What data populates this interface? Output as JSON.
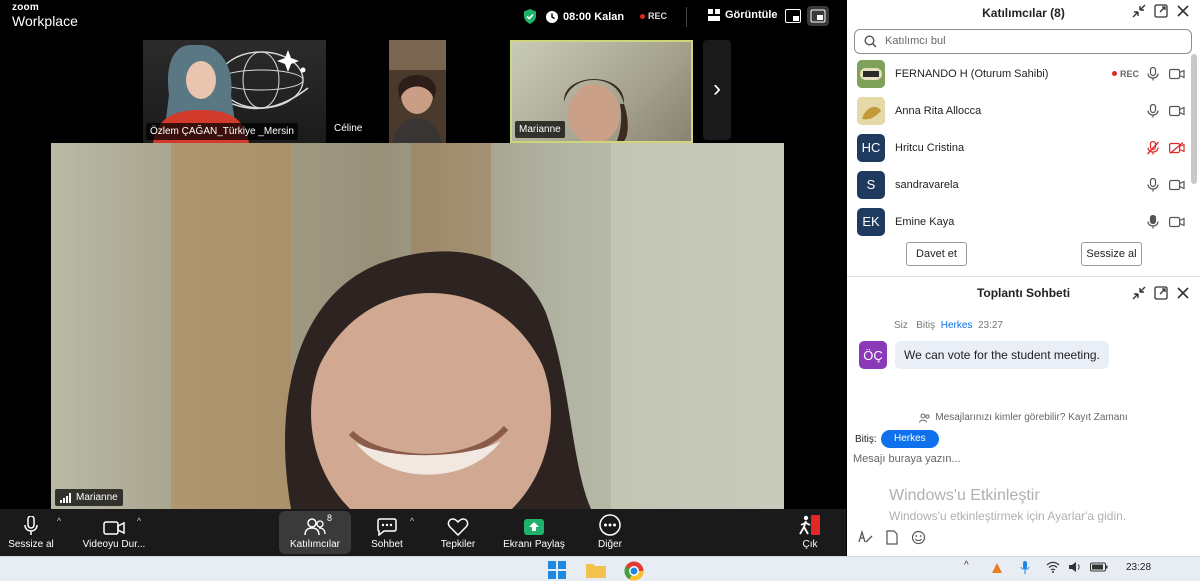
{
  "topbar": {
    "logo_line1": "zoom",
    "logo_line2": "Workplace",
    "timer": "08:00 Kalan",
    "rec": "REC",
    "view_label": "Görüntüle"
  },
  "thumbnails": [
    {
      "name": "Özlem ÇAĞAN_Türkiye _Mersin"
    },
    {
      "name": "Céline"
    },
    {
      "name": "Marianne"
    }
  ],
  "main_video": {
    "name": "Marianne"
  },
  "toolbar": {
    "mute": "Sessize al",
    "video": "Videoyu Dur...",
    "participants": "Katılımcılar",
    "participants_count": "8",
    "chat": "Sohbet",
    "reactions": "Tepkiler",
    "share": "Ekranı Paylaş",
    "more": "Diğer",
    "leave": "Çık"
  },
  "participants_panel": {
    "title": "Katılımcılar (8)",
    "search_placeholder": "Katılımcı bul",
    "rec_label": "REC",
    "items": [
      {
        "name": "FERNANDO H (Oturum Sahibi)",
        "initials": "",
        "color": "#6b8e4e",
        "mic_muted": false
      },
      {
        "name": "Anna Rita Allocca",
        "initials": "",
        "color": "#c9b47a",
        "mic_muted": false
      },
      {
        "name": "Hritcu Cristina",
        "initials": "HC",
        "color": "#1f3a5f",
        "mic_muted": true
      },
      {
        "name": "sandravarela",
        "initials": "S",
        "color": "#1f3a5f",
        "mic_muted": false
      },
      {
        "name": "Emine Kaya",
        "initials": "EK",
        "color": "#1f3a5f",
        "mic_muted": false
      }
    ],
    "invite_button": "Davet et",
    "mute_all_button": "Sessize al"
  },
  "chat_panel": {
    "title": "Toplantı Sohbeti",
    "meta_from": "Siz",
    "meta_to_label": "Bitiş",
    "meta_to": "Herkes",
    "meta_time": "23:27",
    "avatar_initials": "ÖÇ",
    "message": "We can vote for the student meeting.",
    "privacy": "Mesajlarınızı kimler görebilir? Kayıt Zamanı",
    "to_label": "Bitiş:",
    "to_chip": "Herkes",
    "input_placeholder": "Mesajı buraya yazın..."
  },
  "windows_activation": {
    "title": "Windows'u Etkinleştir",
    "subtitle": "Windows'u etkinleştirmek için Ayarlar'a gidin."
  },
  "taskbar": {
    "time": "23:28"
  },
  "colors": {
    "accent_blue": "#0e71eb",
    "rec_red": "#e02828",
    "secure_green": "#20b26b",
    "share_green": "#20b26b",
    "leave_red": "#e02828"
  }
}
